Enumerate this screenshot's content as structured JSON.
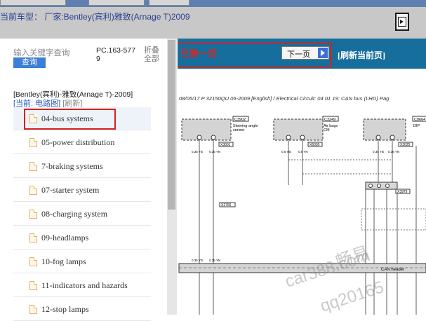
{
  "title_bar": {
    "text": "当前车型：  厂家:Bentley(宾利)雅致(Arnage T)2009"
  },
  "left_panel": {
    "search_placeholder": "输入关键字查询",
    "query_label": "查询",
    "pc_code": "PC.163-5779",
    "collapse_all": "折叠全部",
    "vehicle": "[Bentley(宾利)-雅致(Arnage T)-2009]",
    "crumb_current": "[当前: 电路图]",
    "crumb_refresh": "[刷新]",
    "items": [
      {
        "label": "04-bus systems"
      },
      {
        "label": "05-power distribution"
      },
      {
        "label": "7-braking systems"
      },
      {
        "label": "07-starter system"
      },
      {
        "label": "08-charging system"
      },
      {
        "label": "09-headlamps"
      },
      {
        "label": "10-fog lamps"
      },
      {
        "label": "11-indicators and hazards"
      },
      {
        "label": "12-stop lamps"
      }
    ]
  },
  "viewer": {
    "first_page": "已第一页",
    "next_page": "下一页",
    "refresh_page": "[刷新当前页]",
    "doc_header": "08/05/17   P 32150QU 06-2009 [English] / Electrical Circuit: 04 01 19: CAN bus (LHD)   Pag",
    "schematic": {
      "comp1_code": "C3902",
      "comp1_name_1": "Steering angle",
      "comp1_name_2": "sensor",
      "comp1_conn": "X3001",
      "comp2_code": "C3249",
      "comp2_name_1": "Air bags",
      "comp2_name_2": "CM",
      "comp2_conn": "X6030",
      "comp3_code": "C0664",
      "comp3_name": "DIP",
      "comp3_conn": "X3025",
      "wire_yb": "0.35 YB",
      "wire_yn": "0.35 YN",
      "wire_yb2": "0.5 YB",
      "wire_yn2": "0.5 YN",
      "conn_mid": "X3979",
      "conn_left": "X2766",
      "bus_label": "CAN header"
    }
  },
  "watermark": {
    "line1": "畅易",
    "line2": "car388.com",
    "line3": "qq20165"
  }
}
